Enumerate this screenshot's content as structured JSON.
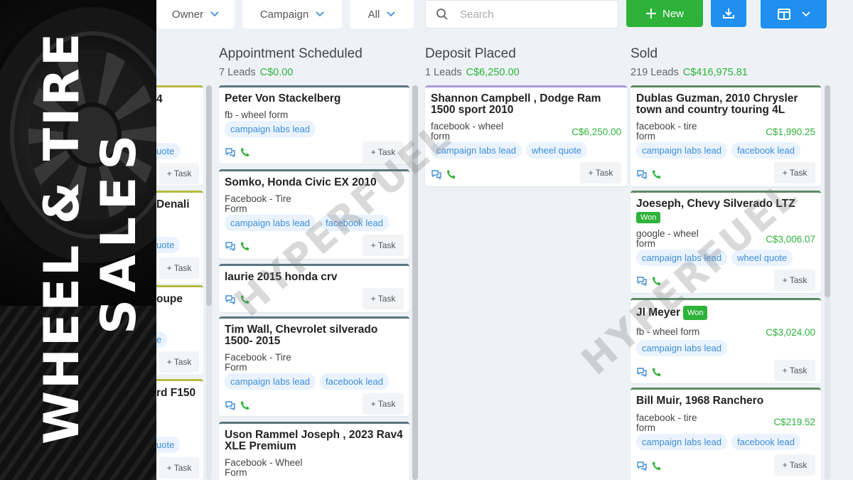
{
  "banner": {
    "line1": "WHEEL & TIRE",
    "line2": "SALES"
  },
  "toolbar": {
    "filters": [
      "Owner",
      "Campaign",
      "All"
    ],
    "search_placeholder": "Search",
    "new_label": "New"
  },
  "watermark": "HYPERFUEL",
  "partial_column": {
    "cards": [
      {
        "title": "4",
        "tag": "uote",
        "task": "+ Task"
      },
      {
        "title": "Denali",
        "tag": "uote",
        "task": "+ Task"
      },
      {
        "title": "oupe",
        "tag": "e",
        "task": "+ Task"
      },
      {
        "title": "rd F150",
        "tag": "uote",
        "task": "+ Task"
      }
    ]
  },
  "columns": [
    {
      "title": "Appointment Scheduled",
      "count": "7 Leads",
      "amount": "C$0.00",
      "cards": [
        {
          "title": "Peter Von Stackelberg",
          "source": "fb - wheel form",
          "tags": [
            "campaign labs lead"
          ],
          "task": "+ Task"
        },
        {
          "title": "Somko, Honda Civic EX 2010",
          "source": "Facebook - Tire Form",
          "tags": [
            "campaign labs lead",
            "facebook lead"
          ],
          "task": "+ Task"
        },
        {
          "title": "laurie 2015 honda crv",
          "source": "",
          "tags": [],
          "task": "+ Task"
        },
        {
          "title": "Tim Wall, Chevrolet silverado 1500- 2015",
          "source": "Facebook - Tire Form",
          "tags": [
            "campaign labs lead",
            "facebook lead"
          ],
          "task": "+ Task"
        },
        {
          "title": "Uson Rammel Joseph , 2023 Rav4 XLE Premium",
          "source": "Facebook - Wheel Form",
          "tags": [],
          "task": ""
        }
      ]
    },
    {
      "title": "Deposit Placed",
      "count": "1 Leads",
      "amount": "C$6,250.00",
      "cards": [
        {
          "title": "Shannon Campbell , Dodge Ram 1500 sport 2010",
          "source": "facebook - wheel form",
          "amount": "C$6,250.00",
          "tags": [
            "campaign labs lead",
            "wheel quote"
          ],
          "task": "+ Task"
        }
      ]
    },
    {
      "title": "Sold",
      "count": "219 Leads",
      "amount": "C$416,975.81",
      "cards": [
        {
          "title": "Dublas Guzman, 2010 Chrysler town and country touring 4L",
          "source": "facebook - tire form",
          "amount": "C$1,990.25",
          "tags": [
            "campaign labs lead",
            "facebook lead"
          ],
          "task": "+ Task"
        },
        {
          "title": "Joeseph, Chevy Silverado LTZ",
          "won": "Won",
          "source": "google - wheel form",
          "amount": "C$3,006.07",
          "tags": [
            "campaign labs lead",
            "wheel quote"
          ],
          "task": "+ Task"
        },
        {
          "title": "Jl Meyer",
          "won": "Won",
          "source": "fb - wheel form",
          "amount": "C$3,024.00",
          "tags": [
            "campaign labs lead"
          ],
          "task": "+ Task"
        },
        {
          "title": "Bill Muir, 1968 Ranchero",
          "source": "facebook - tire form",
          "amount": "C$219.52",
          "tags": [
            "campaign labs lead",
            "facebook lead"
          ],
          "task": "+ Task"
        }
      ]
    }
  ]
}
